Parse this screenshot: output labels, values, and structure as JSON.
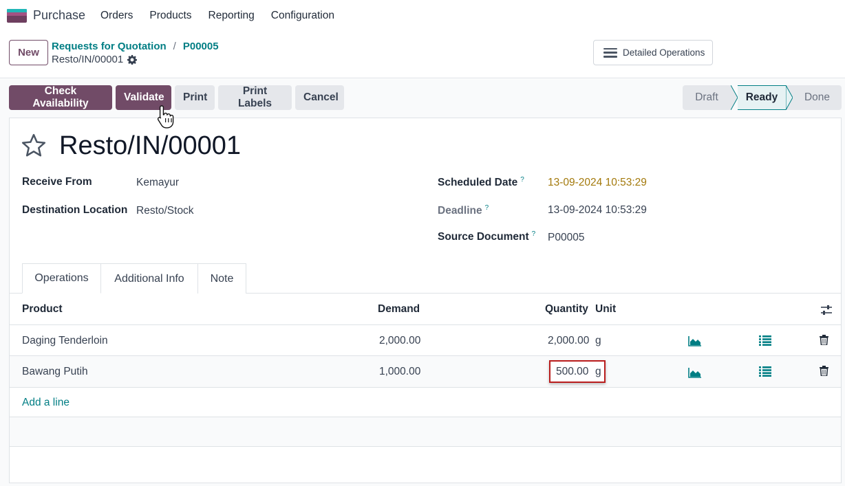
{
  "navbar": {
    "app_name": "Purchase",
    "menu": [
      "Orders",
      "Products",
      "Reporting",
      "Configuration"
    ]
  },
  "control": {
    "new_label": "New",
    "breadcrumb": [
      "Requests for Quotation",
      "P00005"
    ],
    "breadcrumb_sep": "/",
    "record": "Resto/IN/00001",
    "detailed_ops": "Detailed Operations"
  },
  "actions": {
    "check_availability": "Check Availability",
    "validate": "Validate",
    "print": "Print",
    "print_labels": "Print Labels",
    "cancel": "Cancel"
  },
  "stages": {
    "draft": "Draft",
    "ready": "Ready",
    "done": "Done",
    "current": "Ready"
  },
  "form": {
    "title": "Resto/IN/00001",
    "receive_from_label": "Receive From",
    "receive_from": "Kemayur",
    "dest_label": "Destination Location",
    "dest": "Resto/Stock",
    "scheduled_label": "Scheduled Date",
    "scheduled": "13-09-2024 10:53:29",
    "deadline_label": "Deadline",
    "deadline": "13-09-2024 10:53:29",
    "source_label": "Source Document",
    "source": "P00005",
    "help_mark": "?"
  },
  "tabs": [
    "Operations",
    "Additional Info",
    "Note"
  ],
  "table": {
    "headers": {
      "product": "Product",
      "demand": "Demand",
      "quantity": "Quantity",
      "unit": "Unit"
    },
    "rows": [
      {
        "product": "Daging Tenderloin",
        "demand": "2,000.00",
        "quantity": "2,000.00",
        "unit": "g"
      },
      {
        "product": "Bawang Putih",
        "demand": "1,000.00",
        "quantity": "500.00",
        "unit": "g"
      }
    ],
    "add_line": "Add a line"
  },
  "colors": {
    "primary": "#714b67",
    "accent": "#017e84",
    "warning": "#a3790b",
    "highlight_border": "#b91c1c"
  },
  "icons": [
    "star-icon",
    "gear-icon",
    "hamburger-icon",
    "settings-sliders-icon",
    "forecast-chart-icon",
    "details-list-icon",
    "trash-icon",
    "hand-pointer-cursor-icon"
  ]
}
